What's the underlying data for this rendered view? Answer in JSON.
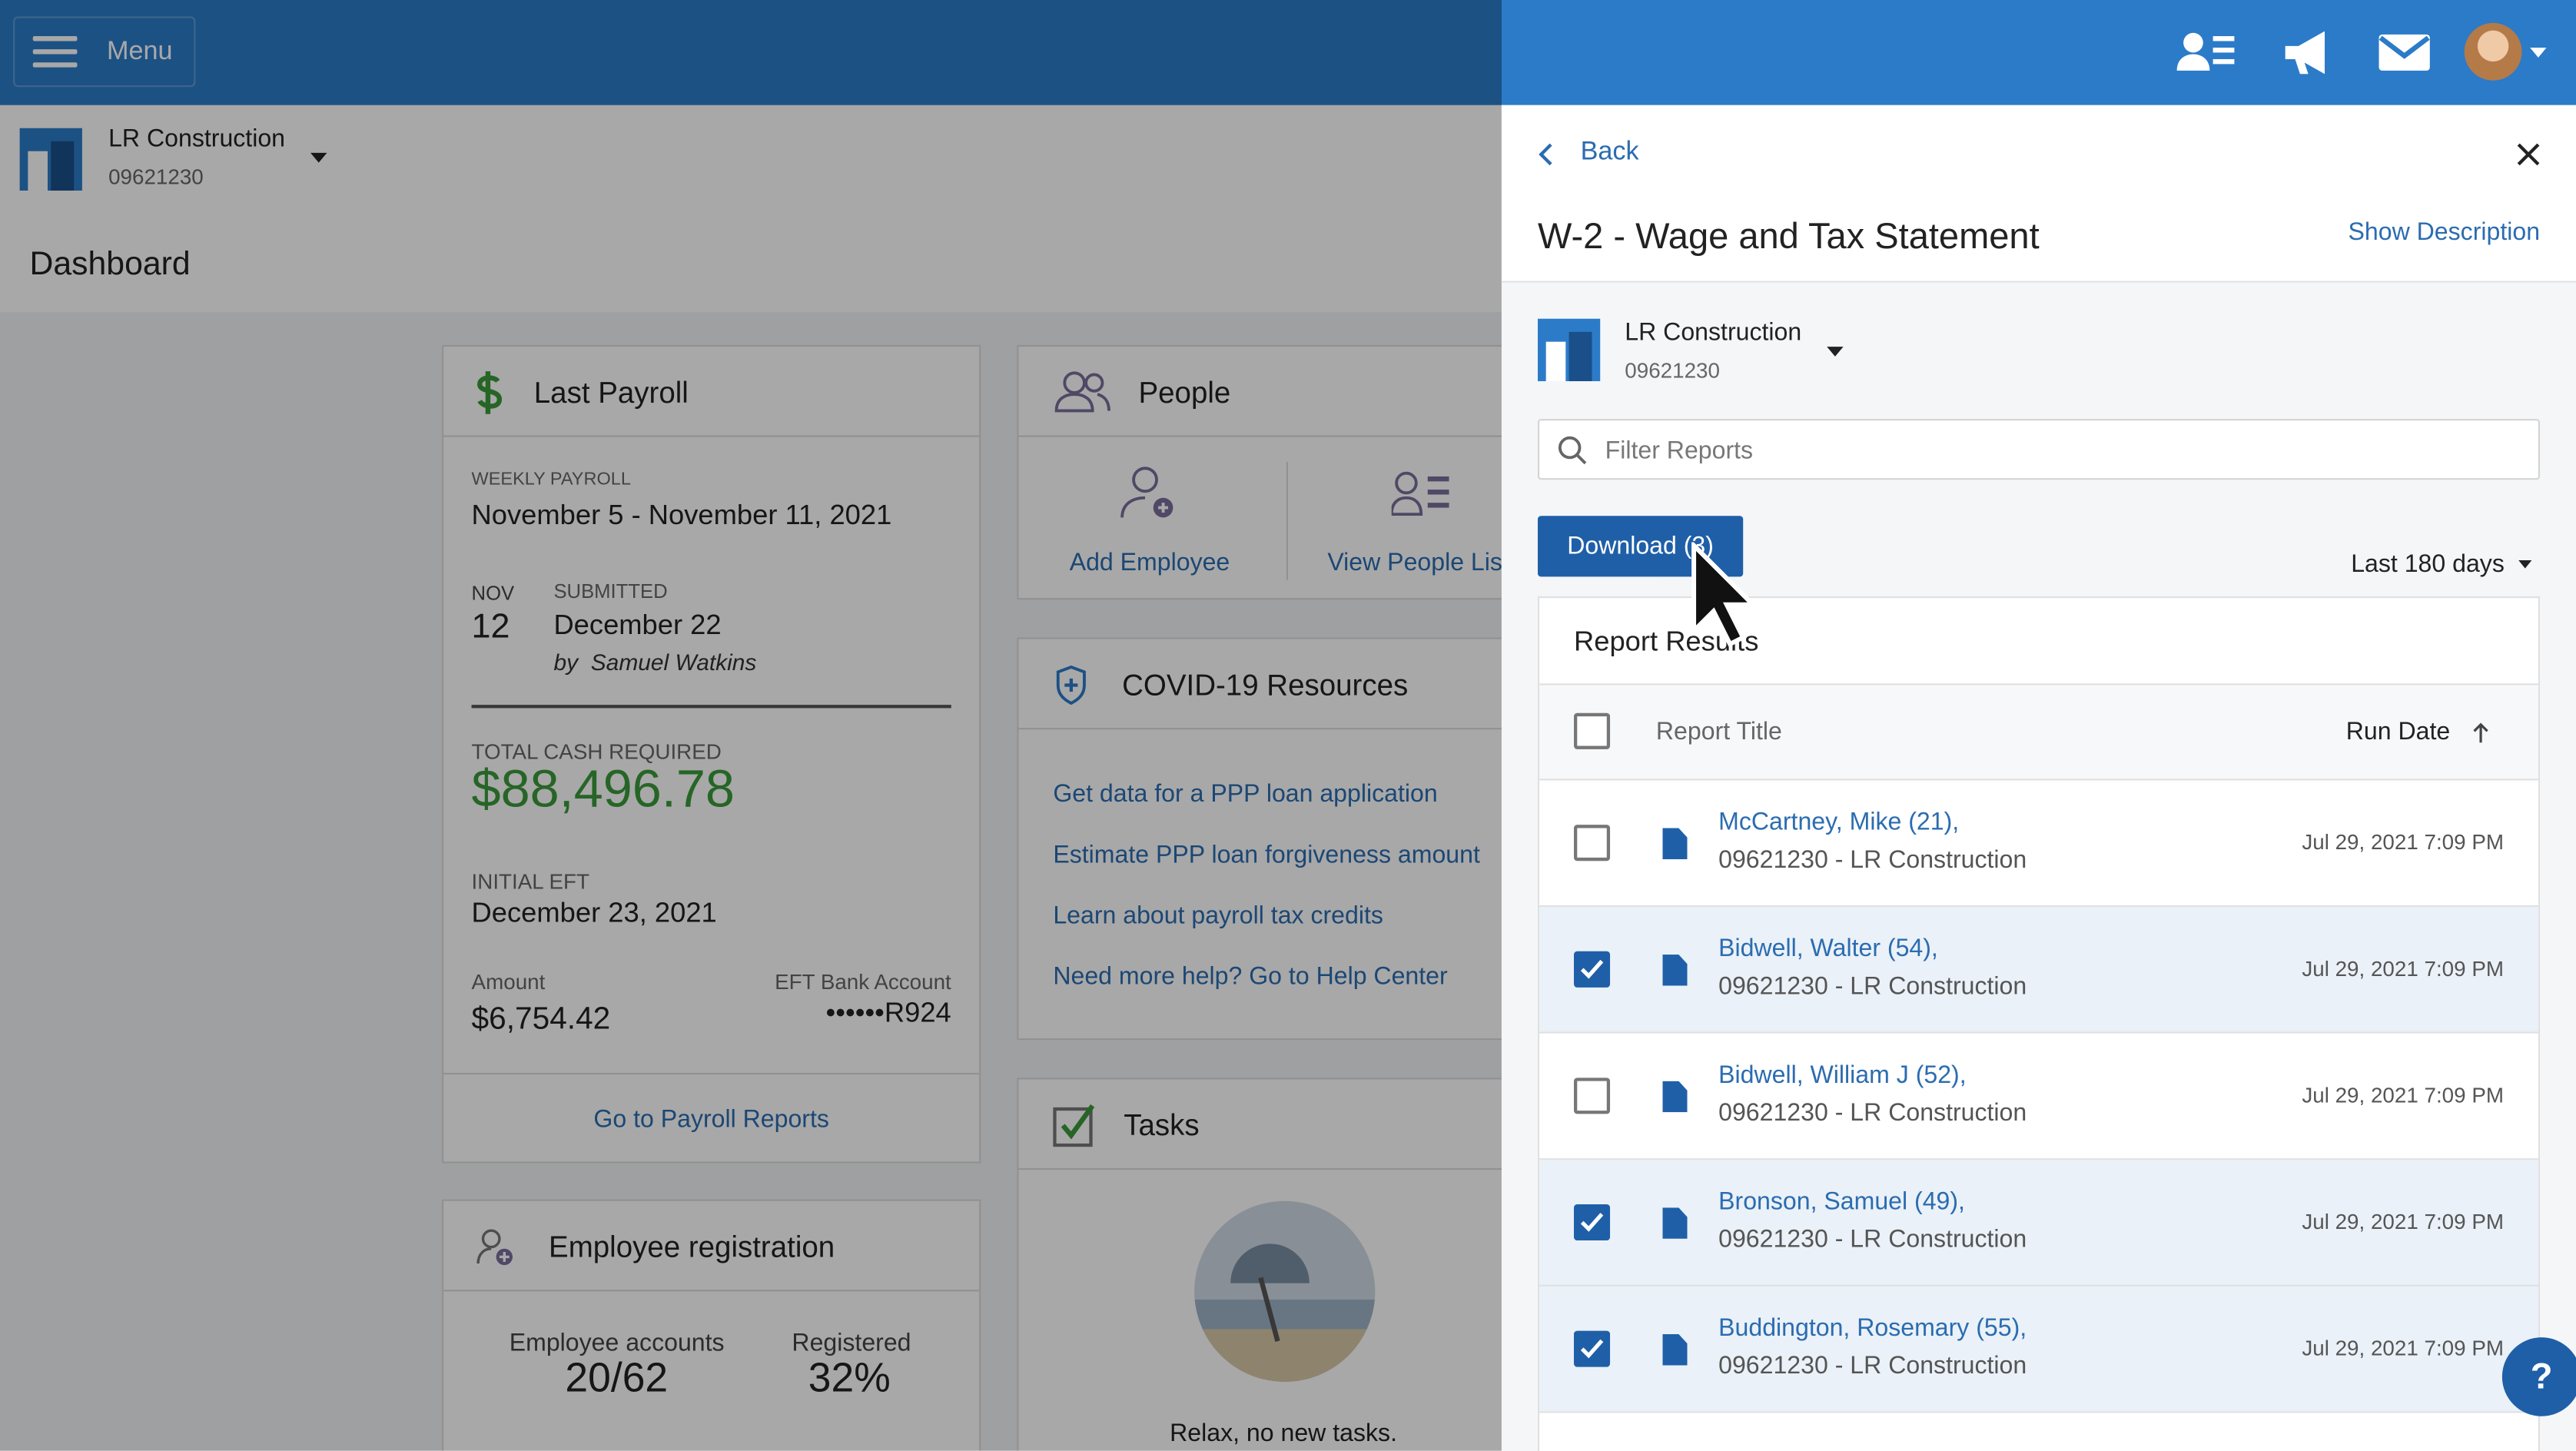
{
  "topbar": {
    "menu_label": "Menu",
    "icons": [
      "people-icon",
      "megaphone-icon",
      "mail-icon",
      "avatar"
    ]
  },
  "company": {
    "name": "LR Construction",
    "number": "09621230"
  },
  "page_title": "Dashboard",
  "last_payroll": {
    "title": "Last Payroll",
    "type_label": "WEEKLY PAYROLL",
    "period": "November 5 - November 11, 2021",
    "month": "NOV",
    "day": "12",
    "submitted_label": "SUBMITTED",
    "submitted_date": "December 22",
    "submitted_by_prefix": "by",
    "submitted_by": "Samuel Watkins",
    "total_label": "TOTAL CASH REQUIRED",
    "total": "$88,496.78",
    "eft_label": "INITIAL EFT",
    "eft_date": "December 23, 2021",
    "amount_label": "Amount",
    "amount": "$6,754.42",
    "bank_label": "EFT Bank Account",
    "bank": "••••••R924",
    "link": "Go to Payroll Reports"
  },
  "people": {
    "title": "People",
    "add": "Add Employee",
    "view": "View People List"
  },
  "covid": {
    "title": "COVID-19 Resources",
    "links": [
      "Get data for a PPP loan application",
      "Estimate PPP loan forgiveness amount",
      "Learn about payroll tax credits",
      "Need more help? Go to Help Center"
    ]
  },
  "tasks": {
    "title": "Tasks",
    "empty": "Relax, no new tasks."
  },
  "registration": {
    "title": "Employee registration",
    "accounts_label": "Employee accounts",
    "accounts": "20/62",
    "registered_label": "Registered",
    "registered": "32%"
  },
  "panel": {
    "back": "Back",
    "title": "W-2 - Wage and Tax Statement",
    "show_description": "Show Description",
    "filter_placeholder": "Filter Reports",
    "download": "Download (3)",
    "range": "Last 180 days",
    "results_title": "Report Results",
    "col_title": "Report Title",
    "col_date": "Run Date",
    "rows": [
      {
        "name": "McCartney, Mike (21),",
        "sub": "09621230 - LR Construction",
        "date": "Jul 29, 2021 7:09 PM",
        "checked": false
      },
      {
        "name": "Bidwell, Walter (54),",
        "sub": "09621230 - LR Construction",
        "date": "Jul 29, 2021 7:09 PM",
        "checked": true
      },
      {
        "name": "Bidwell, William J (52),",
        "sub": "09621230 - LR Construction",
        "date": "Jul 29, 2021 7:09 PM",
        "checked": false
      },
      {
        "name": "Bronson, Samuel (49),",
        "sub": "09621230 - LR Construction",
        "date": "Jul 29, 2021 7:09 PM",
        "checked": true
      },
      {
        "name": "Buddington, Rosemary (55),",
        "sub": "09621230 - LR Construction",
        "date": "Jul 29, 2021 7:09 PM",
        "checked": true
      }
    ]
  },
  "help": "?",
  "colors": {
    "brand": "#2b7bc8",
    "button": "#1f5fa8",
    "money": "#3a9a3a",
    "link": "#2b6cb0"
  }
}
